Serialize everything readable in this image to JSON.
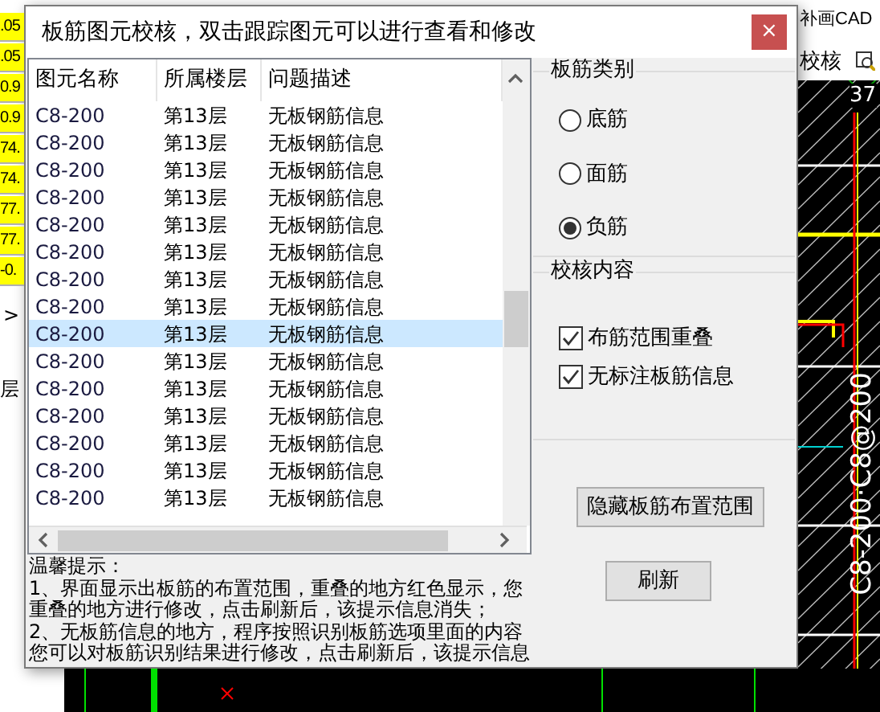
{
  "background": {
    "cells": [
      ".05",
      ".05",
      "0.9",
      "0.9",
      "74.",
      "74.",
      "77.",
      "77.",
      "-0."
    ],
    "side_labels": [
      ">",
      "层"
    ],
    "toolbar": {
      "title": "补画CAD",
      "check_label": "校核"
    },
    "drawing": {
      "circle_label": "37",
      "rebar_label": "C8-200·C8@200"
    }
  },
  "dialog": {
    "title": "板筋图元校核，双击跟踪图元可以进行查看和修改",
    "close": "×",
    "table": {
      "columns": [
        "图元名称",
        "所属楼层",
        "问题描述"
      ],
      "rows": [
        {
          "cells": [
            "C8-200",
            "第13层",
            "无板钢筋信息"
          ],
          "selected": false
        },
        {
          "cells": [
            "C8-200",
            "第13层",
            "无板钢筋信息"
          ],
          "selected": false
        },
        {
          "cells": [
            "C8-200",
            "第13层",
            "无板钢筋信息"
          ],
          "selected": false
        },
        {
          "cells": [
            "C8-200",
            "第13层",
            "无板钢筋信息"
          ],
          "selected": false
        },
        {
          "cells": [
            "C8-200",
            "第13层",
            "无板钢筋信息"
          ],
          "selected": false
        },
        {
          "cells": [
            "C8-200",
            "第13层",
            "无板钢筋信息"
          ],
          "selected": false
        },
        {
          "cells": [
            "C8-200",
            "第13层",
            "无板钢筋信息"
          ],
          "selected": false
        },
        {
          "cells": [
            "C8-200",
            "第13层",
            "无板钢筋信息"
          ],
          "selected": false
        },
        {
          "cells": [
            "C8-200",
            "第13层",
            "无板钢筋信息"
          ],
          "selected": true
        },
        {
          "cells": [
            "C8-200",
            "第13层",
            "无板钢筋信息"
          ],
          "selected": false
        },
        {
          "cells": [
            "C8-200",
            "第13层",
            "无板钢筋信息"
          ],
          "selected": false
        },
        {
          "cells": [
            "C8-200",
            "第13层",
            "无板钢筋信息"
          ],
          "selected": false
        },
        {
          "cells": [
            "C8-200",
            "第13层",
            "无板钢筋信息"
          ],
          "selected": false
        },
        {
          "cells": [
            "C8-200",
            "第13层",
            "无板钢筋信息"
          ],
          "selected": false
        },
        {
          "cells": [
            "C8-200",
            "第13层",
            "无板钢筋信息"
          ],
          "selected": false
        }
      ]
    },
    "hint": {
      "title": "温馨提示：",
      "lines": [
        "1、界面显示出板筋的布置范围，重叠的地方红色显示，您",
        "重叠的地方进行修改，点击刷新后，该提示信息消失；",
        "2、无板筋信息的地方，程序按照识别板筋选项里面的内容",
        "您可以对板筋识别结果进行修改，点击刷新后，该提示信息"
      ]
    },
    "rebar_type": {
      "title": "板筋类别",
      "options": [
        {
          "label": "底筋",
          "selected": false
        },
        {
          "label": "面筋",
          "selected": false
        },
        {
          "label": "负筋",
          "selected": true
        }
      ]
    },
    "check_content": {
      "title": "校核内容",
      "items": [
        {
          "label": "布筋范围重叠",
          "checked": true
        },
        {
          "label": "无标注板筋信息",
          "checked": true
        }
      ]
    },
    "buttons": [
      "隐藏板筋布置范围",
      "刷新"
    ]
  }
}
